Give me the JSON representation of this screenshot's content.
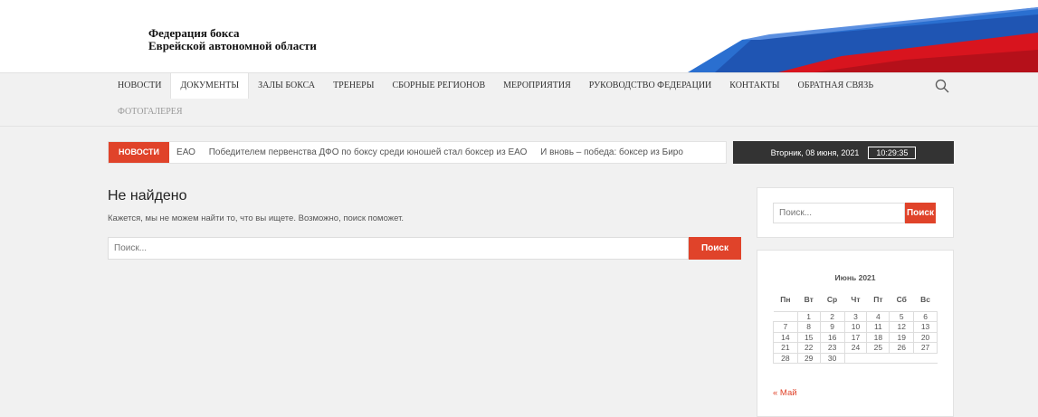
{
  "site": {
    "title_line1": "Федерация бокса",
    "title_line2": "Еврейской автономной области"
  },
  "nav": {
    "items": [
      {
        "label": "НОВОСТИ"
      },
      {
        "label": "ДОКУМЕНТЫ"
      },
      {
        "label": "ЗАЛЫ БОКСА"
      },
      {
        "label": "ТРЕНЕРЫ"
      },
      {
        "label": "СБОРНЫЕ РЕГИОНОВ"
      },
      {
        "label": "МЕРОПРИЯТИЯ"
      },
      {
        "label": "РУКОВОДСТВО ФЕДЕРАЦИИ"
      },
      {
        "label": "КОНТАКТЫ"
      },
      {
        "label": "ОБРАТНАЯ СВЯЗЬ"
      }
    ],
    "second_row": {
      "label": "ФОТОГАЛЕРЕЯ"
    },
    "active": "ДОКУМЕНТЫ",
    "search_icon": "search-icon"
  },
  "ticker": {
    "label": "НОВОСТИ",
    "items": [
      "ЕАО",
      "Победителем первенства ДФО по боксу среди юношей стал боксер из ЕАО",
      "И вновь – победа: боксер из Биро"
    ]
  },
  "datebar": {
    "date": "Вторник, 08 июня, 2021",
    "time": "10:29:35"
  },
  "main": {
    "title": "Не найдено",
    "description": "Кажется, мы не можем найти то, что вы ищете. Возможно, поиск поможет.",
    "search_placeholder": "Поиск...",
    "search_button": "Поиск"
  },
  "sidebar": {
    "search_placeholder": "Поиск...",
    "search_button": "Поиск",
    "calendar": {
      "caption": "Июнь 2021",
      "weekdays": [
        "Пн",
        "Вт",
        "Ср",
        "Чт",
        "Пт",
        "Сб",
        "Вс"
      ],
      "weeks": [
        [
          "",
          "1",
          "2",
          "3",
          "4",
          "5",
          "6"
        ],
        [
          "7",
          "8",
          "9",
          "10",
          "11",
          "12",
          "13"
        ],
        [
          "14",
          "15",
          "16",
          "17",
          "18",
          "19",
          "20"
        ],
        [
          "21",
          "22",
          "23",
          "24",
          "25",
          "26",
          "27"
        ],
        [
          "28",
          "29",
          "30",
          "",
          "",
          "",
          ""
        ]
      ],
      "prev_link": "« Май"
    }
  },
  "colors": {
    "accent": "#e0432a",
    "dark": "#333333",
    "banner_blue": "#1f55b3",
    "banner_red": "#d8141e"
  }
}
